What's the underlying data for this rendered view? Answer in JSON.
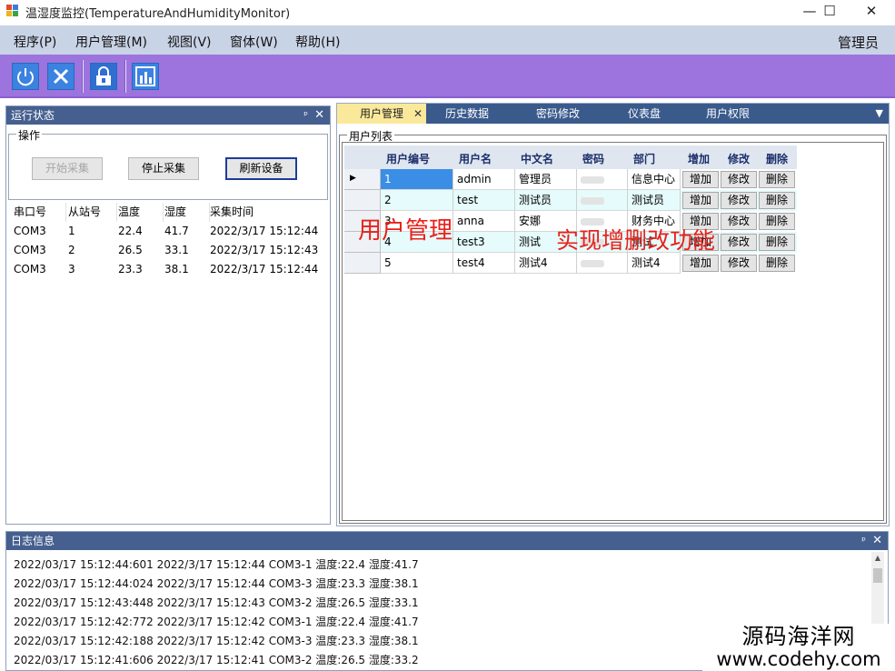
{
  "window": {
    "title": "温湿度监控(TemperatureAndHumidityMonitor)",
    "minimize": "—",
    "maximize": "☐",
    "close": "✕"
  },
  "menubar": {
    "items": [
      "程序(P)",
      "用户管理(M)",
      "视图(V)",
      "窗体(W)",
      "帮助(H)"
    ],
    "user": "管理员"
  },
  "toolbar": {
    "buttons": [
      "power-icon",
      "close-icon",
      "lock-icon",
      "chart-icon"
    ]
  },
  "left_panel": {
    "title": "运行状态",
    "pin": "ᵖ",
    "close": "✕",
    "ops_title": "操作",
    "start_label": "开始采集",
    "stop_label": "停止采集",
    "refresh_label": "刷新设备",
    "table": {
      "headers": [
        "串口号",
        "从站号",
        "温度",
        "湿度",
        "采集时间"
      ],
      "rows": [
        [
          "COM3",
          "1",
          "22.4",
          "41.7",
          "2022/3/17 15:12:44"
        ],
        [
          "COM3",
          "2",
          "26.5",
          "33.1",
          "2022/3/17 15:12:43"
        ],
        [
          "COM3",
          "3",
          "23.3",
          "38.1",
          "2022/3/17 15:12:44"
        ]
      ]
    }
  },
  "tabs": {
    "items": [
      "用户管理",
      "历史数据",
      "密码修改",
      "仪表盘",
      "用户权限"
    ],
    "active_close": "✕",
    "menu": "▼"
  },
  "users": {
    "group_title": "用户列表",
    "headers": [
      "用户编号",
      "用户名",
      "中文名",
      "密码",
      "部门",
      "增加",
      "修改",
      "删除"
    ],
    "rows": [
      [
        "1",
        "admin",
        "管理员",
        "",
        "信息中心"
      ],
      [
        "2",
        "test",
        "测试员",
        "",
        "测试员"
      ],
      [
        "3",
        "anna",
        "安娜",
        "",
        "财务中心"
      ],
      [
        "4",
        "test3",
        "测试",
        "",
        "测试"
      ],
      [
        "5",
        "test4",
        "测试4",
        "",
        "测试4"
      ]
    ],
    "btn_add": "增加",
    "btn_edit": "修改",
    "btn_delete": "删除",
    "current_marker": "▶"
  },
  "overlay": {
    "caption1": "用户管理",
    "caption2": "实现增删改功能",
    "color": "#e8211a"
  },
  "log_panel": {
    "title": "日志信息",
    "pin": "ᵖ",
    "close": "✕",
    "lines": [
      "2022/03/17 15:12:44:601  2022/3/17 15:12:44 COM3-1 温度:22.4 湿度:41.7",
      "2022/03/17 15:12:44:024  2022/3/17 15:12:44 COM3-3 温度:23.3 湿度:38.1",
      "2022/03/17 15:12:43:448  2022/3/17 15:12:43 COM3-2 温度:26.5 湿度:33.1",
      "2022/03/17 15:12:42:772  2022/3/17 15:12:42 COM3-1 温度:22.4 湿度:41.7",
      "2022/03/17 15:12:42:188  2022/3/17 15:12:42 COM3-3 温度:23.3 湿度:38.1",
      "2022/03/17 15:12:41:606  2022/3/17 15:12:41 COM3-2 温度:26.5 湿度:33.2"
    ]
  },
  "watermark": {
    "name": "源码海洋网",
    "url": "www.codehy.com"
  },
  "colors": {
    "toolbar_bg": "#9d74dd",
    "panel_header": "#455f8f",
    "tab_active": "#fbe99b",
    "grid_selected": "#3a8ee6",
    "grid_alt_row": "#e6fbfb"
  }
}
